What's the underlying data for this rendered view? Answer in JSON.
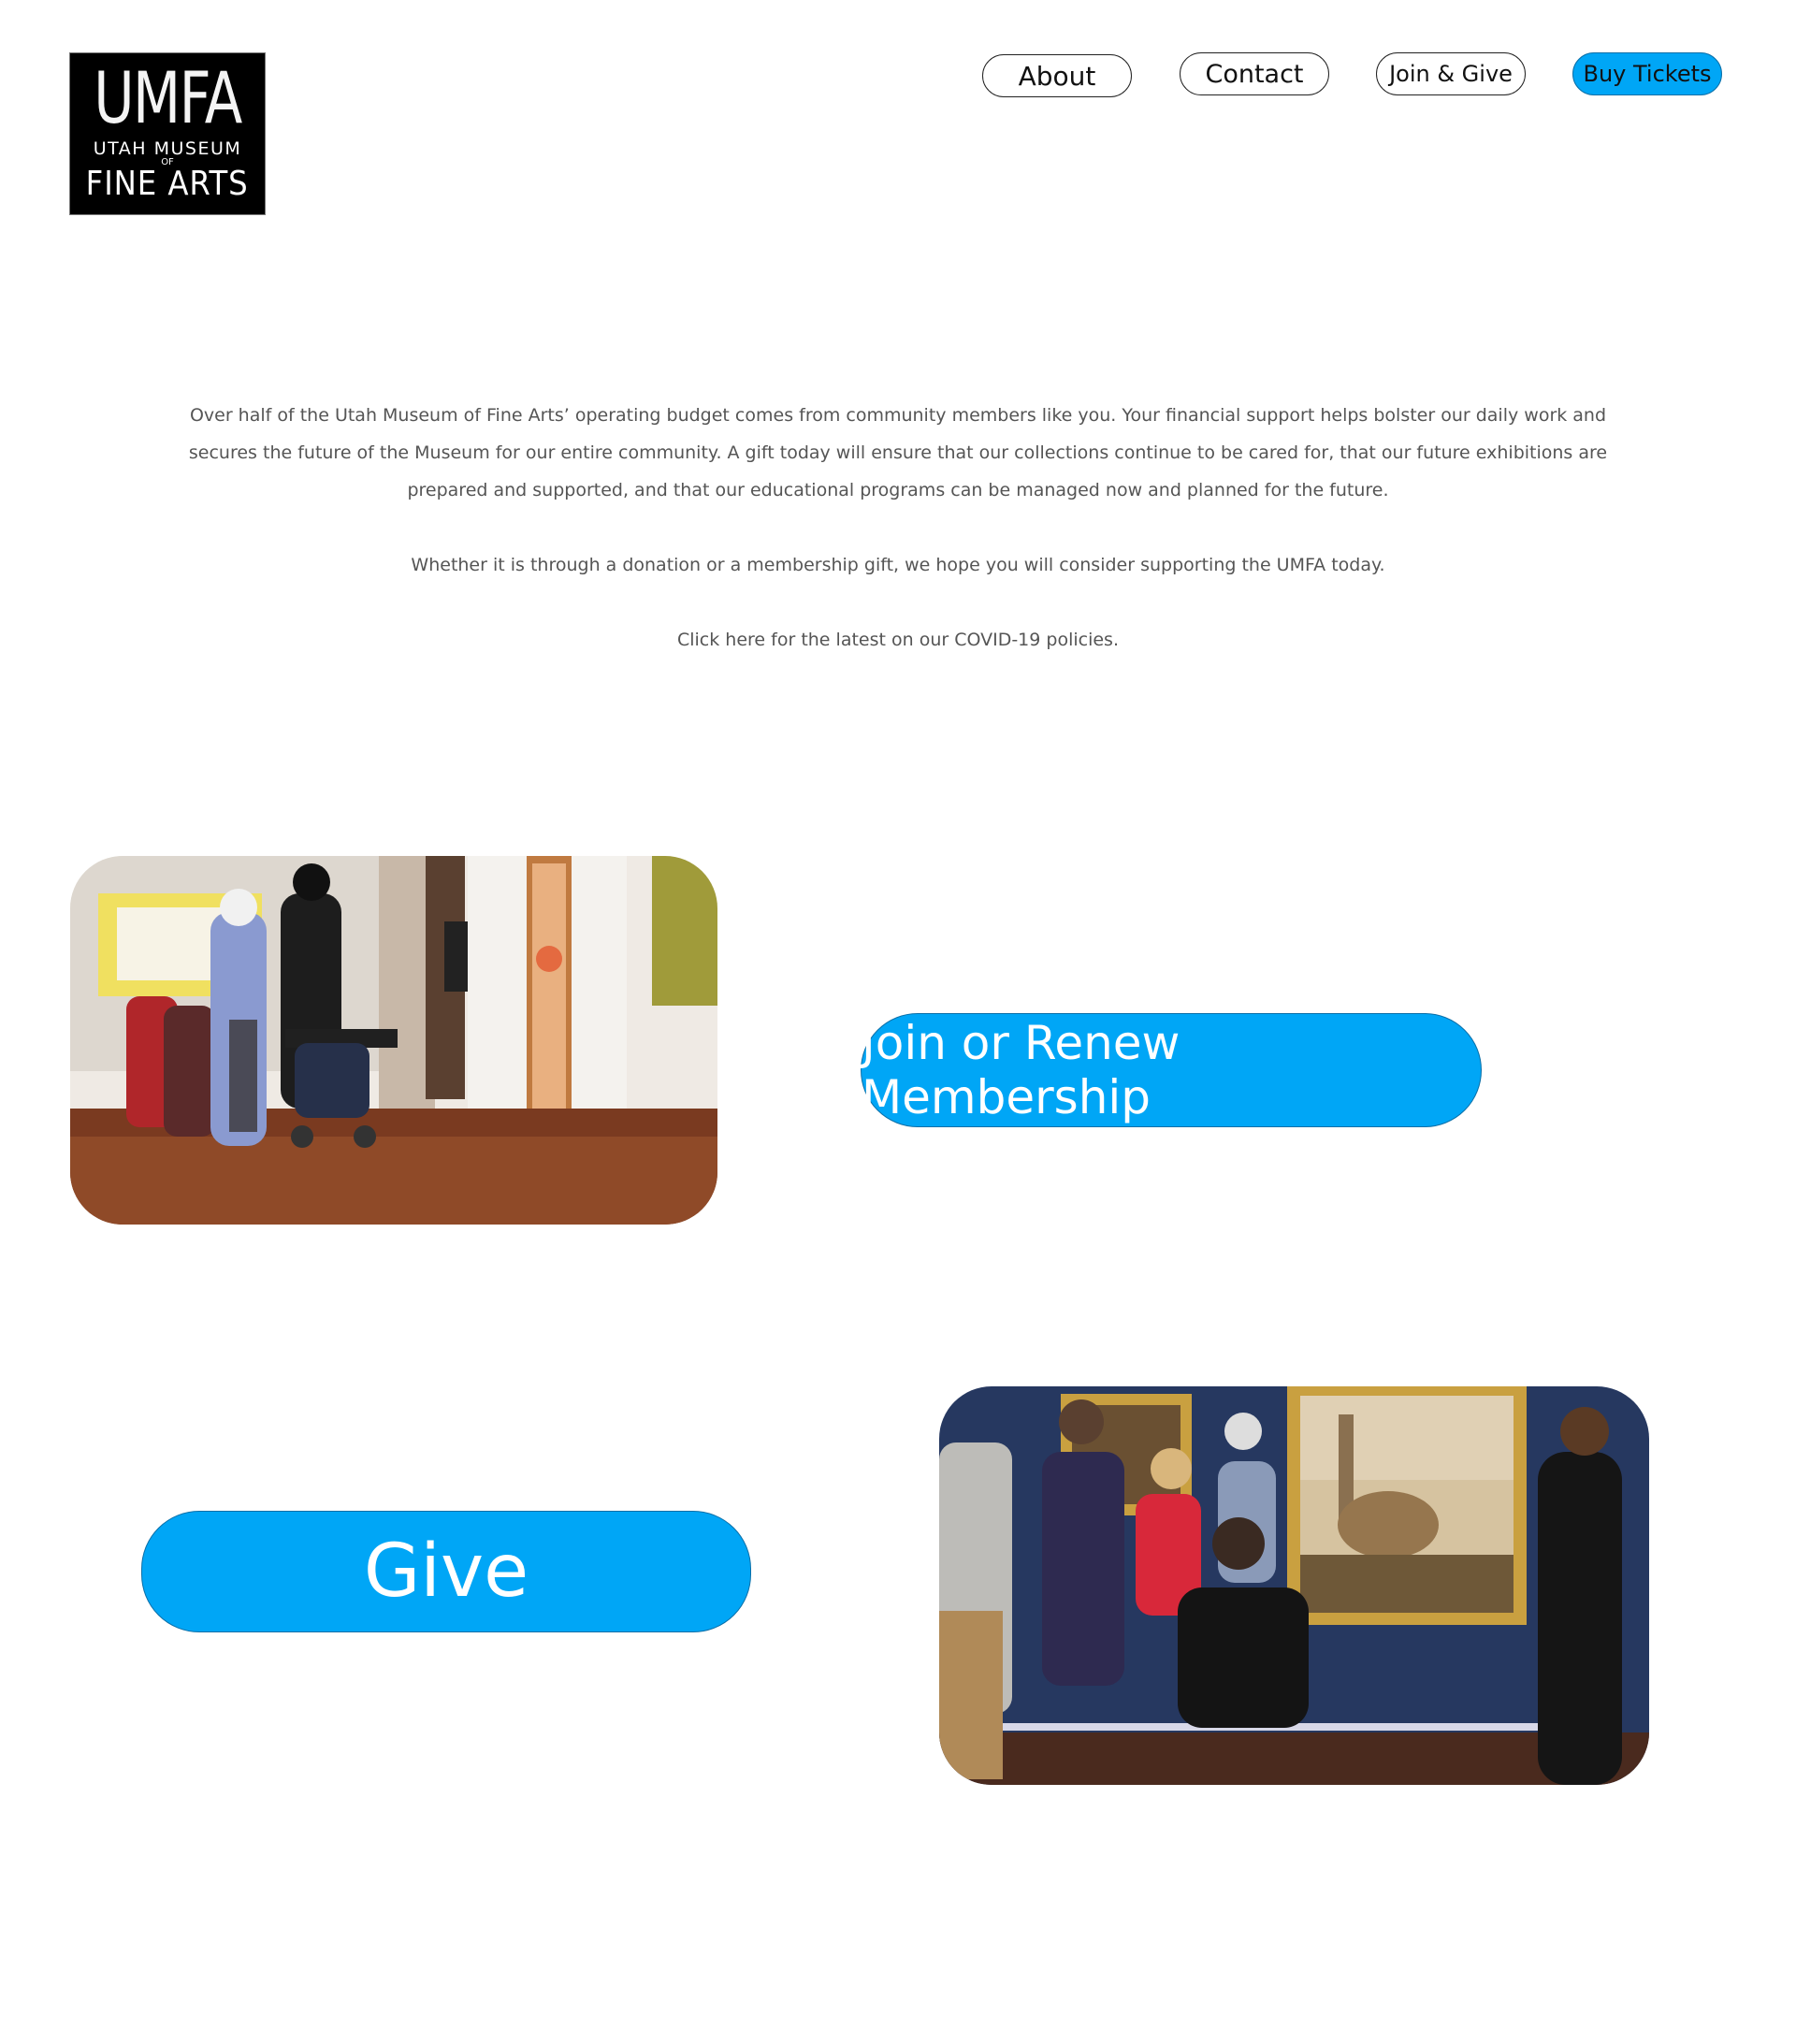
{
  "logo": {
    "line1": "UMFA",
    "line2": "UTAH MUSEUM",
    "line3": "OF",
    "line4": "FINE ARTS"
  },
  "nav": {
    "about": "About",
    "contact": "Contact",
    "join_give": "Join & Give",
    "buy_tickets": "Buy Tickets"
  },
  "intro": {
    "paragraph1": "Over half of the Utah Museum of Fine Arts’ operating budget comes from community members like you. Your financial support helps bolster our daily work and secures the future of the Museum for our entire community. A gift today will ensure that our collections continue to be cared for, that our future exhibitions are prepared and supported, and that our educational programs can be managed now and planned for the future.",
    "paragraph2": "Whether it is through a donation or a membership gift, we hope you will consider supporting the UMFA today.",
    "paragraph3": "Click here for the latest on our COVID-19 policies."
  },
  "cta": {
    "membership": "Join or Renew Membership",
    "give": "Give"
  },
  "colors": {
    "accent": "#00a6f6",
    "text_muted": "#555555"
  }
}
